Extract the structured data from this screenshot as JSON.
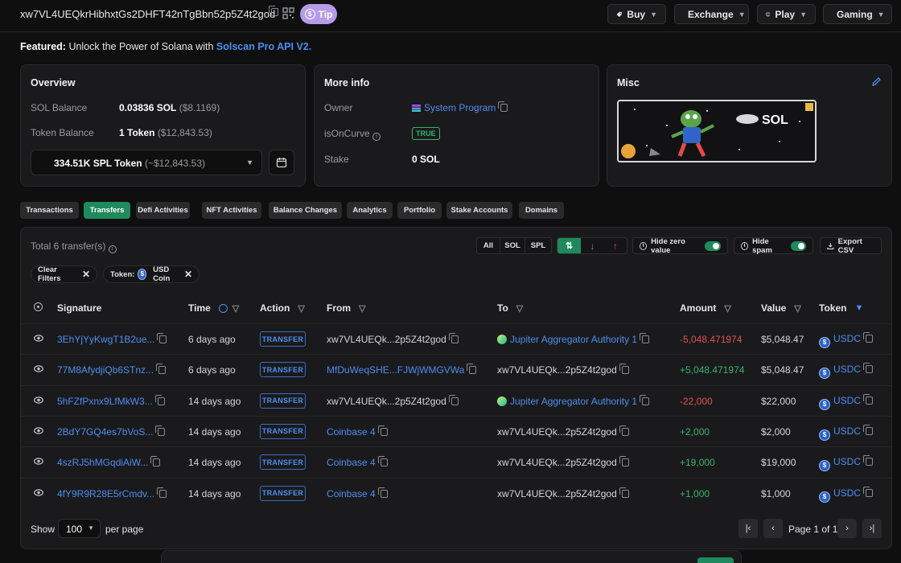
{
  "header": {
    "address": "xw7VL4UEQkrHibhxtGs2DHFT42nTgBbn52p5Z4t2god",
    "tip_label": "Tip",
    "nav": [
      {
        "label": "Buy",
        "icon": "buy-tag-icon"
      },
      {
        "label": "Exchange",
        "icon": "exchange-icon"
      },
      {
        "label": "Play",
        "icon": "play-icon"
      },
      {
        "label": "Gaming",
        "icon": "gamepad-icon"
      }
    ]
  },
  "featured": {
    "prefix": "Featured:",
    "text": "Unlock the Power of Solana with",
    "link": "Solscan Pro API V2."
  },
  "overview": {
    "title": "Overview",
    "sol_balance_label": "SOL Balance",
    "sol_balance_value": "0.03836 SOL",
    "sol_balance_usd": "($8.1169)",
    "token_balance_label": "Token Balance",
    "token_balance_value": "1 Token",
    "token_balance_usd": "($12,843.53)",
    "token_select_value": "334.51K SPL Token",
    "token_select_usd": "(~$12,843.53)"
  },
  "more_info": {
    "title": "More info",
    "owner_label": "Owner",
    "owner_value": "System Program",
    "isoncurve_label": "isOnCurve",
    "isoncurve_value": "TRUE",
    "stake_label": "Stake",
    "stake_value": "0 SOL"
  },
  "misc": {
    "title": "Misc",
    "image_text": "SOL"
  },
  "tabs": [
    {
      "label": "Transactions",
      "active": false
    },
    {
      "label": "Transfers",
      "active": true
    },
    {
      "label": "Defi Activities",
      "active": false
    },
    {
      "label": "NFT Activities",
      "active": false
    },
    {
      "label": "Balance Changes",
      "active": false
    },
    {
      "label": "Analytics",
      "active": false
    },
    {
      "label": "Portfolio",
      "active": false
    },
    {
      "label": "Stake Accounts",
      "active": false
    },
    {
      "label": "Domains",
      "active": false
    }
  ],
  "transfers": {
    "total_label": "Total 6 transfer(s)",
    "filter_all": "All",
    "filter_sol": "SOL",
    "filter_spl": "SPL",
    "hide_zero_label": "Hide zero value",
    "hide_spam_label": "Hide spam",
    "export_label": "Export CSV",
    "clear_filters_label": "Clear Filters",
    "token_filter_label": "Token:",
    "token_filter_value": "USD Coin",
    "columns": {
      "signature": "Signature",
      "time": "Time",
      "action": "Action",
      "from": "From",
      "to": "To",
      "amount": "Amount",
      "value": "Value",
      "token": "Token"
    },
    "rows": [
      {
        "signature": "3EhYjYyKwgT1B2ue...",
        "time": "6 days ago",
        "action": "TRANSFER",
        "from": "xw7VL4UEQk...2p5Z4t2god",
        "to": "Jupiter Aggregator Authority 1",
        "amount": "-5,048.471974",
        "value": "$5,048.47",
        "token": "USDC"
      },
      {
        "signature": "77M8AfydjiQb6STnz...",
        "time": "6 days ago",
        "action": "TRANSFER",
        "from": "MfDuWeqSHE...FJWjWMGVWa",
        "to": "xw7VL4UEQk...2p5Z4t2god",
        "amount": "+5,048.471974",
        "value": "$5,048.47",
        "token": "USDC"
      },
      {
        "signature": "5hFZfPxnx9LfMkW3...",
        "time": "14 days ago",
        "action": "TRANSFER",
        "from": "xw7VL4UEQk...2p5Z4t2god",
        "to": "Jupiter Aggregator Authority 1",
        "amount": "-22,000",
        "value": "$22,000",
        "token": "USDC"
      },
      {
        "signature": "2BdY7GQ4es7bVoS...",
        "time": "14 days ago",
        "action": "TRANSFER",
        "from": "Coinbase 4",
        "to": "xw7VL4UEQk...2p5Z4t2god",
        "amount": "+2,000",
        "value": "$2,000",
        "token": "USDC"
      },
      {
        "signature": "4szRJ5hMGqdiAiW...",
        "time": "14 days ago",
        "action": "TRANSFER",
        "from": "Coinbase 4",
        "to": "xw7VL4UEQk...2p5Z4t2god",
        "amount": "+19,000",
        "value": "$19,000",
        "token": "USDC"
      },
      {
        "signature": "4fY9R9R28E5rCmdv...",
        "time": "14 days ago",
        "action": "TRANSFER",
        "from": "Coinbase 4",
        "to": "xw7VL4UEQk...2p5Z4t2god",
        "amount": "+1,000",
        "value": "$1,000",
        "token": "USDC"
      }
    ]
  },
  "pagination": {
    "show_label": "Show",
    "per_page_value": "100",
    "per_page_label": "per page",
    "page_info": "Page 1 of 1"
  },
  "colors": {
    "accent_green": "#1f8a5d",
    "link_blue": "#4d8ef0",
    "negative": "#e05151",
    "positive": "#35b46b",
    "tip_purple": "#b69be8"
  }
}
